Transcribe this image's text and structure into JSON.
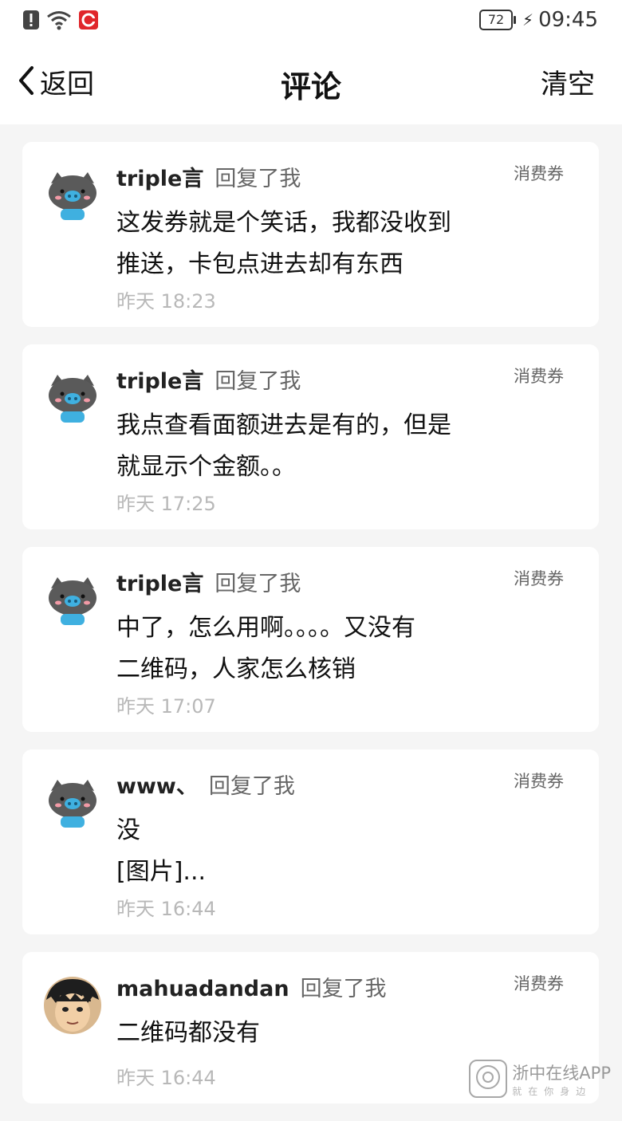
{
  "status_bar": {
    "battery": "72",
    "time": "09:45"
  },
  "nav": {
    "back_label": "返回",
    "title": "评论",
    "clear_label": "清空"
  },
  "comments": [
    {
      "username": "triple言",
      "reply_text": "回复了我",
      "tag": "消费券",
      "content": "这发券就是个笑话，我都没收到\n推送，卡包点进去却有东西",
      "time": "昨天 18:23"
    },
    {
      "username": "triple言",
      "reply_text": "回复了我",
      "tag": "消费券",
      "content": "我点查看面额进去是有的，但是\n就显示个金额。。",
      "time": "昨天 17:25"
    },
    {
      "username": "triple言",
      "reply_text": "回复了我",
      "tag": "消费券",
      "content": "中了，怎么用啊。。。。又没有\n二维码，人家怎么核销",
      "time": "昨天 17:07"
    },
    {
      "username": "www、",
      "reply_text": "回复了我",
      "tag": "消费券",
      "content": "没\n[图片]...",
      "time": "昨天 16:44"
    },
    {
      "username": "mahuadandan",
      "reply_text": "回复了我",
      "tag": "消费券",
      "content": "二维码都没有",
      "time": "昨天 16:44"
    }
  ],
  "watermark": {
    "title": "浙中在线APP",
    "sub": "就在你身边"
  }
}
